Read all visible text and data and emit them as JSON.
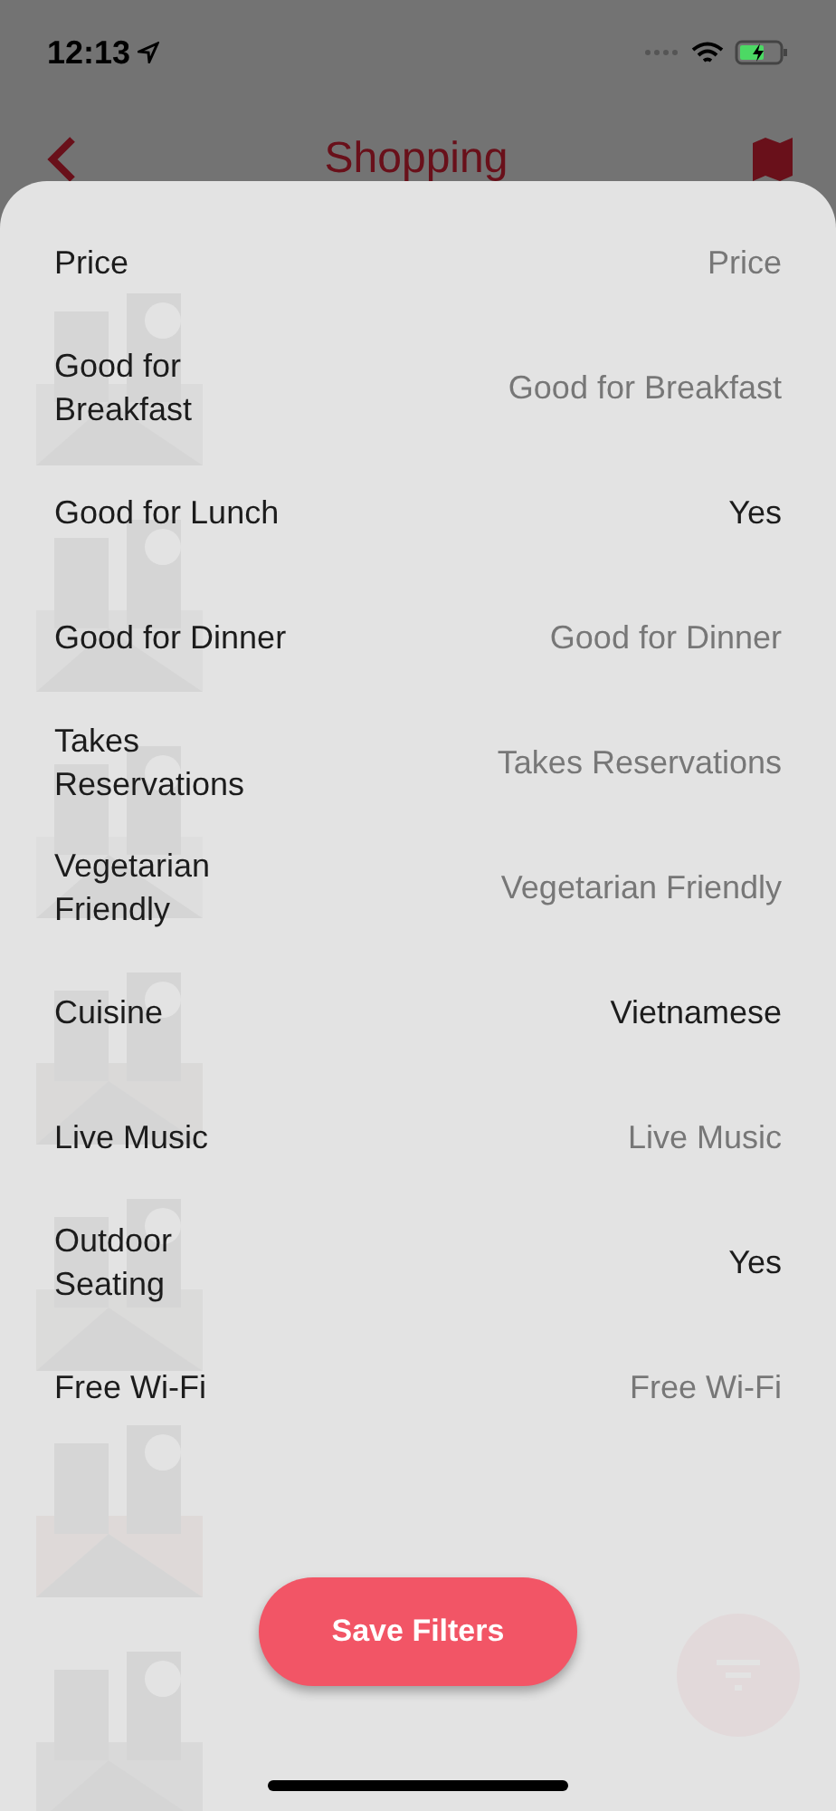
{
  "status_bar": {
    "time": "12:13"
  },
  "nav_bar": {
    "title": "Shopping"
  },
  "filters": [
    {
      "label": "Price",
      "value": "Price",
      "set": false
    },
    {
      "label": "Good for Breakfast",
      "value": "Good for Breakfast",
      "set": false
    },
    {
      "label": "Good for Lunch",
      "value": "Yes",
      "set": true
    },
    {
      "label": "Good for Dinner",
      "value": "Good for Dinner",
      "set": false
    },
    {
      "label": "Takes Reservations",
      "value": "Takes Reservations",
      "set": false
    },
    {
      "label": "Vegetarian Friendly",
      "value": "Vegetarian Friendly",
      "set": false
    },
    {
      "label": "Cuisine",
      "value": "Vietnamese",
      "set": true
    },
    {
      "label": "Live Music",
      "value": "Live Music",
      "set": false
    },
    {
      "label": "Outdoor Seating",
      "value": "Yes",
      "set": true
    },
    {
      "label": "Free Wi-Fi",
      "value": "Free Wi-Fi",
      "set": false
    }
  ],
  "save_button": "Save Filters"
}
